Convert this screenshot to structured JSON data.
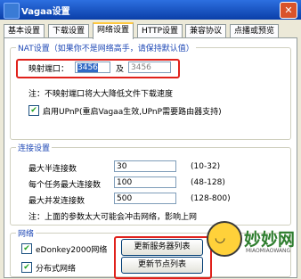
{
  "window": {
    "title": "Vagaa设置",
    "close_symbol": "✕"
  },
  "tabs": [
    {
      "label": "基本设置"
    },
    {
      "label": "下载设置"
    },
    {
      "label": "网络设置",
      "active": true
    },
    {
      "label": "HTTP设置"
    },
    {
      "label": "兼容协议"
    },
    {
      "label": "点播或预览"
    }
  ],
  "nat": {
    "legend": "NAT设置（如果你不是网络高手，请保持默认值）",
    "port_label": "映射端口：",
    "port1": "3456",
    "separator": "及",
    "port2": "3456",
    "note": "注：不映射端口将大大降低文件下载速度",
    "upnp_label": "启用UPnP(重启Vagaa生效,UPnP需要路由器支持)",
    "upnp_checked": true
  },
  "connection": {
    "legend": "连接设置",
    "rows": [
      {
        "label": "最大半连接数",
        "value": "30",
        "range": "(10-32)"
      },
      {
        "label": "每个任务最大连接数",
        "value": "100",
        "range": "(48-128)"
      },
      {
        "label": "最大并发连接数",
        "value": "500",
        "range": "(128-800)"
      }
    ],
    "note": "注：上面的参数太大可能会冲击网络，影响上网"
  },
  "network": {
    "legend": "网络",
    "edonkey_label": "eDonkey2000网络",
    "edonkey_checked": true,
    "dist_label": "分布式网络",
    "dist_checked": true,
    "update_servers": "更新服务器列表",
    "update_nodes": "更新节点列表"
  },
  "watermark": {
    "name": "妙妙网",
    "sub": "MIAOMIAOWANG"
  },
  "colors": {
    "highlight": "#e0211b",
    "title_bar": "#0a3fa8",
    "legend_text": "#1f49b6"
  }
}
